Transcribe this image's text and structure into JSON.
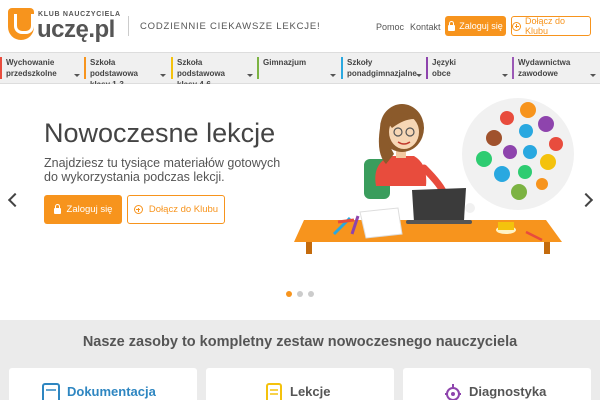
{
  "header": {
    "logo_club": "KLUB NAUCZYCIELA",
    "logo_name": "uczę.pl",
    "tagline": "CODZIENNIE CIEKAWSZE LEKCJE!",
    "links": [
      "Pomoc",
      "Kontakt"
    ],
    "login_label": "Zaloguj się",
    "join_label": "Dołącz do Klubu"
  },
  "nav": {
    "items": [
      {
        "label": "Wychowanie przedszkolne",
        "color": "#e84c3d"
      },
      {
        "label": "Szkoła podstawowa klasy 1-3",
        "color": "#f7941d"
      },
      {
        "label": "Szkoła podstawowa klasy 4-6",
        "color": "#f4c20d"
      },
      {
        "label": "Gimnazjum",
        "color": "#7cb342"
      },
      {
        "label": "Szkoły ponadgimnazjalne",
        "color": "#29a8e0"
      },
      {
        "label": "Języki obce",
        "color": "#8e44ad"
      },
      {
        "label": "Wydawnictwa zawodowe",
        "color": "#9b59b6"
      }
    ]
  },
  "hero": {
    "title": "Nowoczesne lekcje",
    "subtitle": "Znajdziesz tu tysiące materiałów gotowych do wykorzystania podczas lekcji.",
    "login_label": "Zaloguj się",
    "join_label": "Dołącz do Klubu",
    "slides_count": 3,
    "active_slide": 1
  },
  "section": {
    "title": "Nasze zasoby to kompletny zestaw nowoczesnego nauczyciela",
    "cards": [
      {
        "label": "Dokumentacja",
        "color": "#2e86c1",
        "icon": "document-icon"
      },
      {
        "label": "Lekcje",
        "color": "#555555",
        "icon": "lessons-icon"
      },
      {
        "label": "Diagnostyka",
        "color": "#555555",
        "icon": "gear-icon"
      }
    ]
  },
  "colors": {
    "accent": "#f7941d",
    "nav_bg": "#f0f0f0",
    "section_bg": "#ebebeb"
  }
}
